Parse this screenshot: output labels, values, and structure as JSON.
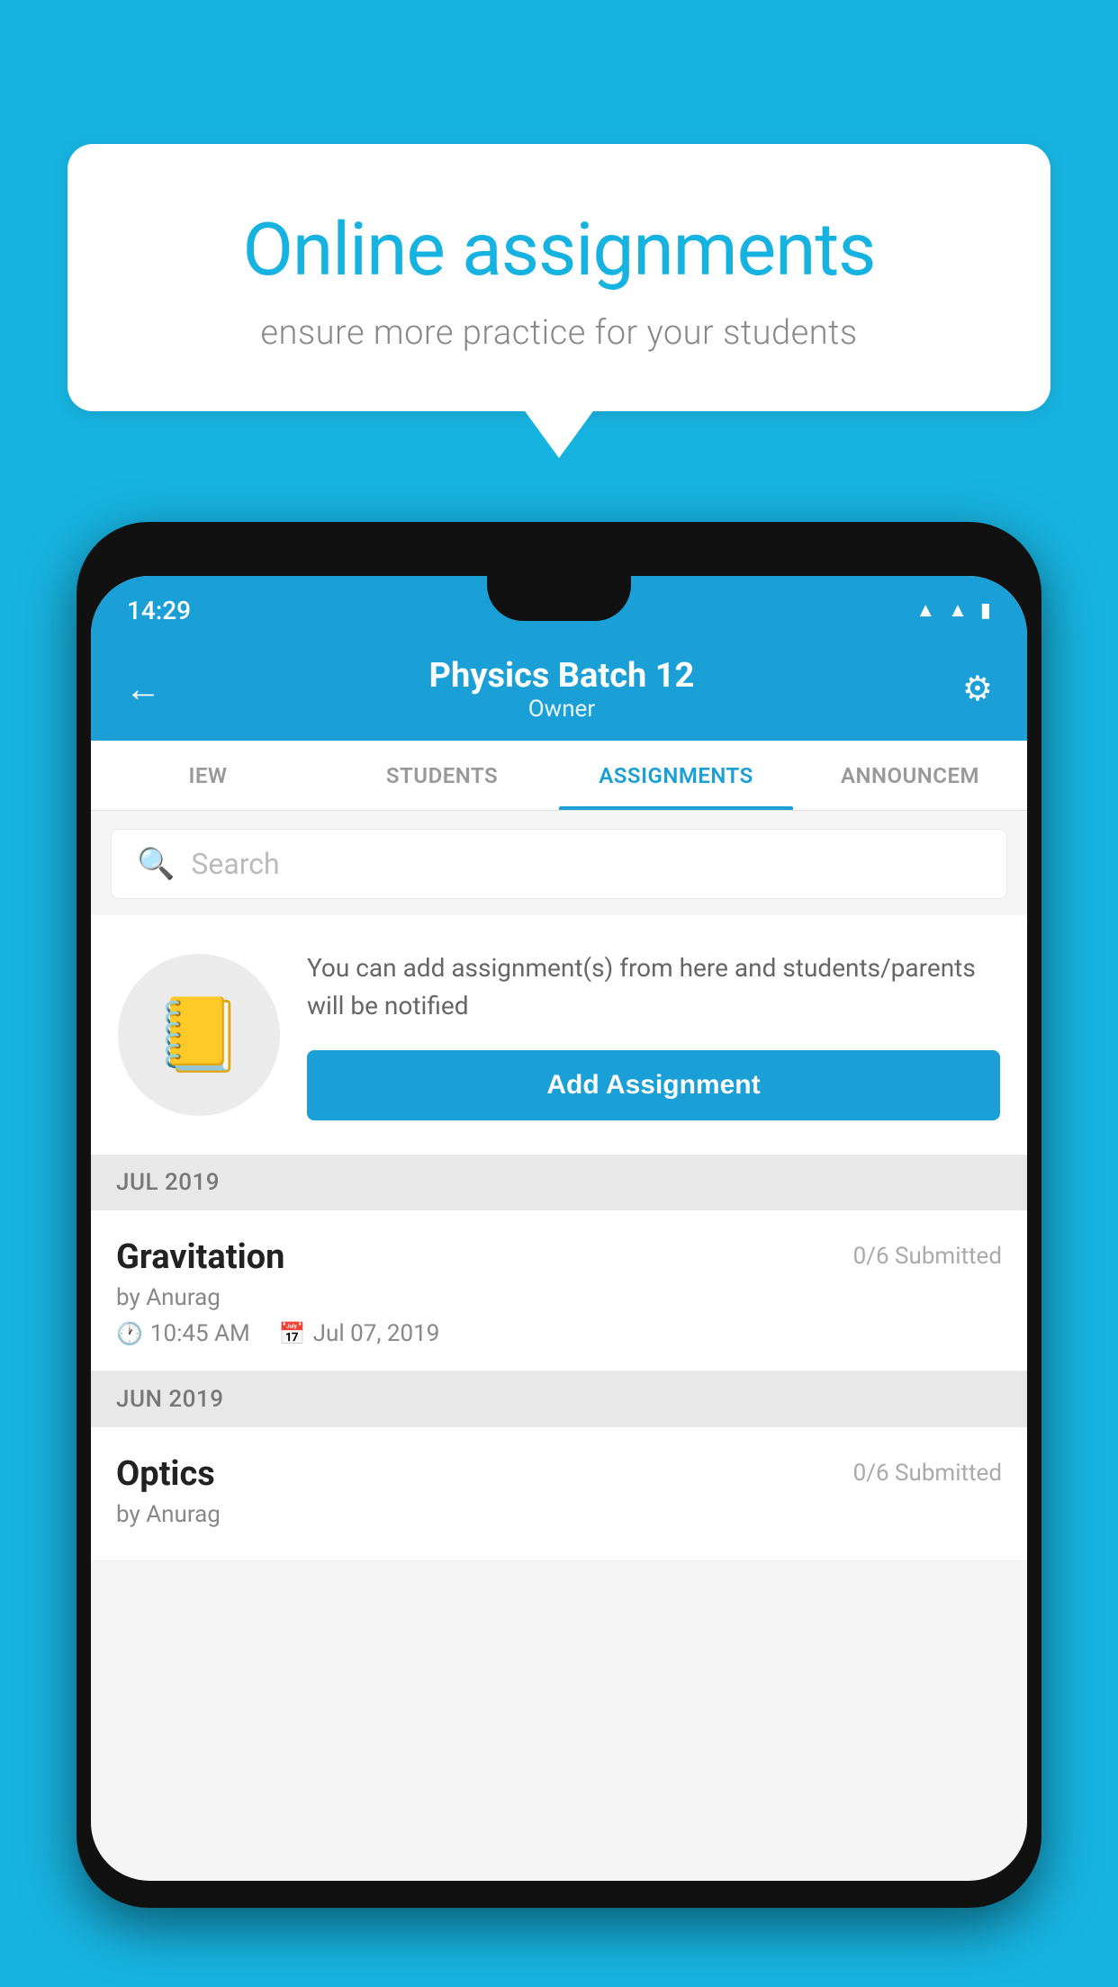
{
  "background_color": "#17b3e0",
  "speech_bubble": {
    "title": "Online assignments",
    "subtitle": "ensure more practice for your students"
  },
  "phone": {
    "status_bar": {
      "time": "14:29",
      "wifi": "wifi",
      "signal": "signal",
      "battery": "battery"
    },
    "header": {
      "title": "Physics Batch 12",
      "subtitle": "Owner",
      "back_label": "←",
      "settings_label": "⚙"
    },
    "tabs": [
      {
        "label": "IEW",
        "active": false
      },
      {
        "label": "STUDENTS",
        "active": false
      },
      {
        "label": "ASSIGNMENTS",
        "active": true
      },
      {
        "label": "ANNOUNCEM",
        "active": false
      }
    ],
    "search": {
      "placeholder": "Search"
    },
    "promo_card": {
      "text": "You can add assignment(s) from here and students/parents will be notified",
      "button_label": "Add Assignment"
    },
    "sections": [
      {
        "header": "JUL 2019",
        "assignments": [
          {
            "title": "Gravitation",
            "submitted": "0/6 Submitted",
            "author": "by Anurag",
            "time": "10:45 AM",
            "date": "Jul 07, 2019"
          }
        ]
      },
      {
        "header": "JUN 2019",
        "assignments": [
          {
            "title": "Optics",
            "submitted": "0/6 Submitted",
            "author": "by Anurag",
            "time": "",
            "date": ""
          }
        ]
      }
    ]
  }
}
